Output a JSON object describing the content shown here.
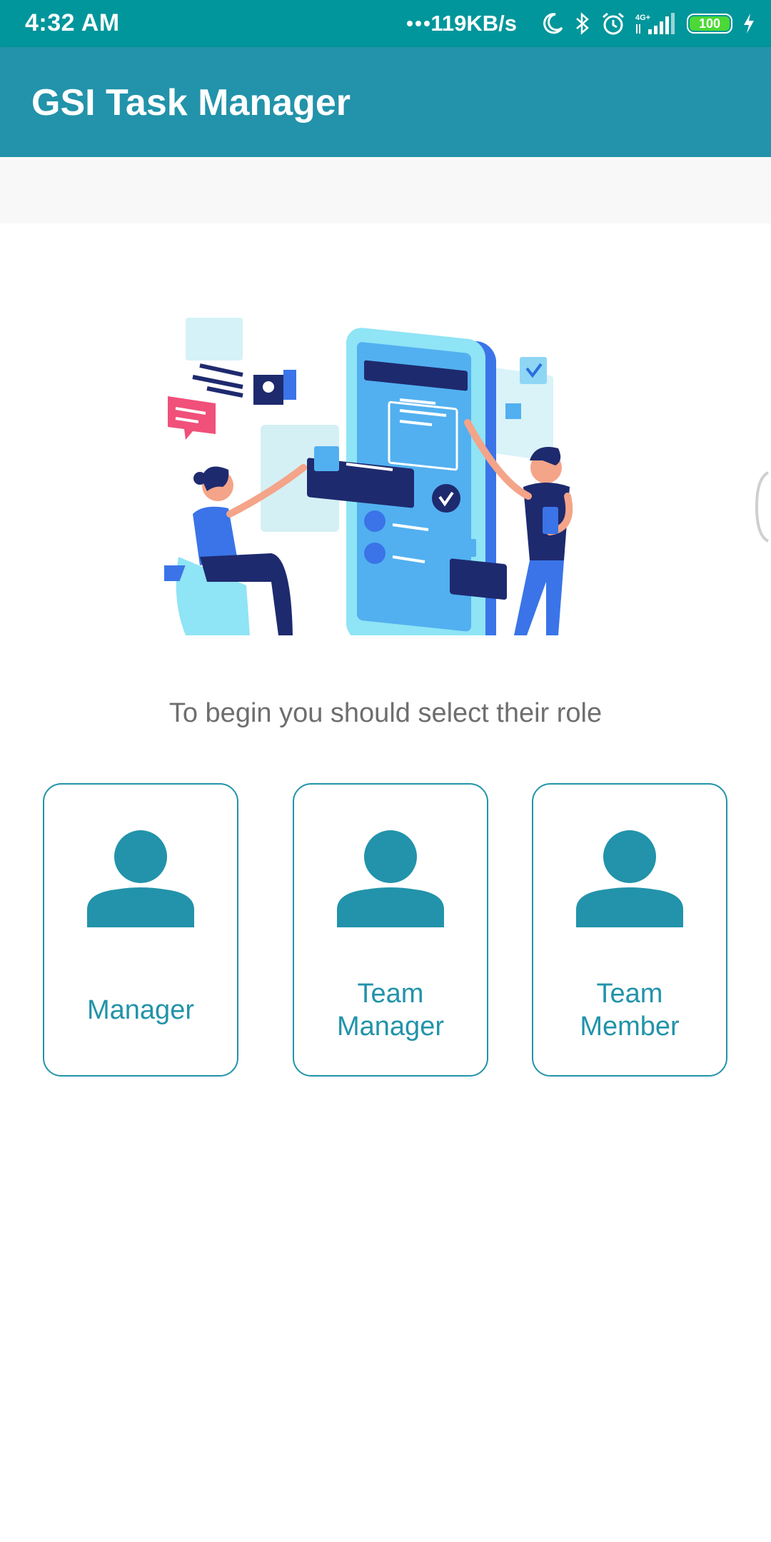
{
  "status_bar": {
    "time": "4:32 AM",
    "net_speed": "119KB/s",
    "battery_level": "100",
    "network_type": "4G+",
    "icons": [
      "dots-icon",
      "moon-icon",
      "bluetooth-icon",
      "alarm-icon",
      "signal-icon",
      "battery-icon",
      "charging-icon"
    ]
  },
  "app_bar": {
    "title": "GSI Task Manager"
  },
  "main": {
    "illustration_icon": "team-app-illustration",
    "prompt": "To begin you should select their role",
    "roles": [
      {
        "label": "Manager",
        "icon": "person-icon"
      },
      {
        "label_line1": "Team",
        "label_line2": "Manager",
        "icon": "person-icon"
      },
      {
        "label_line1": "Team",
        "label_line2": "Member",
        "icon": "person-icon"
      }
    ]
  },
  "colors": {
    "status_bar": "#00969b",
    "app_bar": "#2293aa",
    "accent": "#2293aa",
    "prompt_text": "#6e6e6e",
    "battery_fill": "#4cd836"
  }
}
